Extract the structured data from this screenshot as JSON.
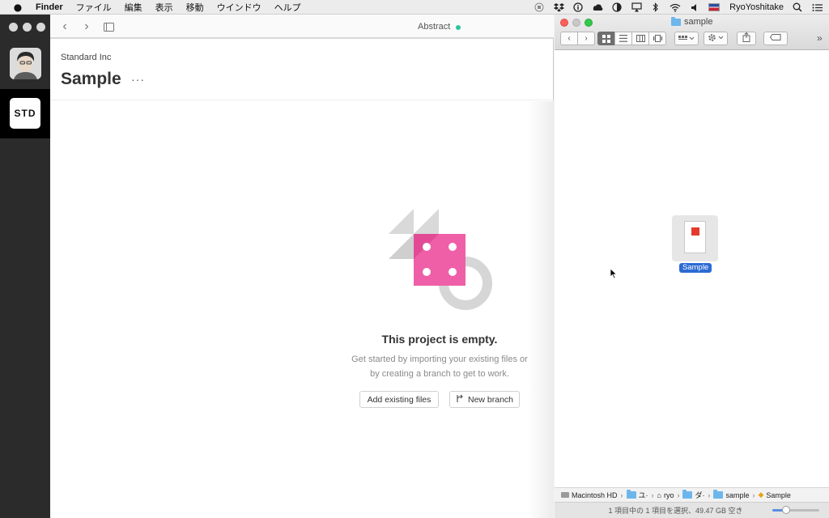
{
  "menubar": {
    "apple_icon": "apple-icon",
    "items": [
      "Finder",
      "ファイル",
      "編集",
      "表示",
      "移動",
      "ウインドウ",
      "ヘルプ"
    ],
    "status_icons": [
      "stop-icon",
      "dropbox-icon",
      "info-icon",
      "cloud-icon",
      "contrast-icon",
      "airplay-icon",
      "bluetooth-icon",
      "wifi-icon",
      "volume-icon",
      "flag-icon"
    ],
    "username": "RyoYoshitake",
    "spotlight_icon": "search-icon",
    "notifications_icon": "list-icon"
  },
  "abstract": {
    "window_title": "Abstract",
    "status_color": "#2ec4a0",
    "sidebar": {
      "org_badge": "STD"
    },
    "header": {
      "org_name": "Standard Inc",
      "project_name": "Sample",
      "more_label": "···"
    },
    "empty_state": {
      "title": "This project is empty.",
      "description_line1": "Get started by importing your existing files or",
      "description_line2": "by creating a branch to get to work.",
      "add_files_label": "Add existing files",
      "new_branch_label": "New branch"
    }
  },
  "finder": {
    "window_title": "sample",
    "file": {
      "name": "Sample"
    },
    "path": [
      {
        "label": "Macintosh HD",
        "icon": "hd-icon"
      },
      {
        "label": "ユ·",
        "icon": "folder-icon"
      },
      {
        "label": "ryo",
        "icon": "home-icon"
      },
      {
        "label": "ダ·",
        "icon": "folder-icon"
      },
      {
        "label": "sample",
        "icon": "folder-icon"
      },
      {
        "label": "Sample",
        "icon": "sketch-file-icon"
      }
    ],
    "status_text": "1 項目中の 1 項目を選択、49.47 GB 空き",
    "zoom_level": 0.3
  }
}
